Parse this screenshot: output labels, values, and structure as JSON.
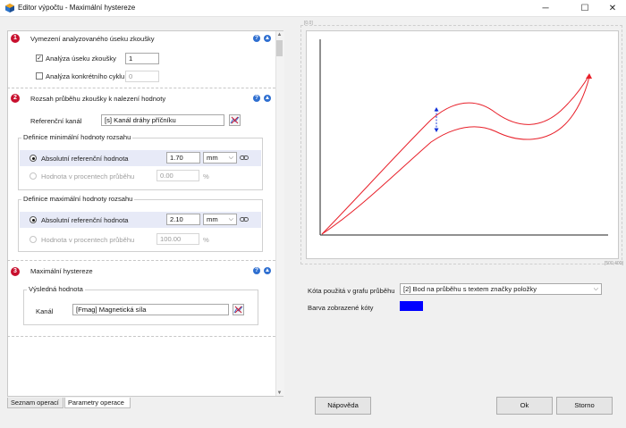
{
  "window": {
    "title": "Editor výpočtu - Maximální hystereze",
    "controls": {
      "minimize": "─",
      "maximize": "☐",
      "close": "✕"
    }
  },
  "section1": {
    "num": "1",
    "title": "Vymezení analyzovaného úseku zkoušky",
    "help": "?",
    "collapse": "▲",
    "analyza_useku": {
      "checked": true,
      "label": "Analýza úseku zkoušky",
      "value": "1"
    },
    "analyza_cyklu": {
      "checked": false,
      "label": "Analýza konkrétního cyklu",
      "value": "0"
    }
  },
  "section2": {
    "num": "2",
    "title": "Rozsah průběhu zkoušky k nalezení hodnoty",
    "help": "?",
    "collapse": "▲",
    "ref_channel_label": "Referenční kanál",
    "ref_channel_value": "[s]  Kanál dráhy příčníku",
    "min_group": {
      "title": "Definice minimální hodnoty rozsahu",
      "abs_label": "Absolutní referenční hodnota",
      "abs_value": "1.70",
      "unit": "mm",
      "pct_label": "Hodnota v procentech průběhu",
      "pct_value": "0.00",
      "pct_unit": "%"
    },
    "max_group": {
      "title": "Definice maximální hodnoty rozsahu",
      "abs_label": "Absolutní referenční hodnota",
      "abs_value": "2.10",
      "unit": "mm",
      "pct_label": "Hodnota v procentech průběhu",
      "pct_value": "100.00",
      "pct_unit": "%"
    }
  },
  "section3": {
    "num": "3",
    "title": "Maximální hystereze",
    "help": "?",
    "collapse": "▲",
    "result_group_title": "Výsledná hodnota",
    "channel_label": "Kanál",
    "channel_value": "[Fmag]  Magnetická síla"
  },
  "tabs": [
    "Seznam operací",
    "Parametry operace"
  ],
  "chart": {
    "corner_top_left": "[0,0]",
    "corner_bottom_right": "[500,400]",
    "colors": {
      "curve": "#e8202a",
      "arrow": "#1030d8",
      "axis": "#222222"
    }
  },
  "kota": {
    "label": "Kóta použitá v grafu průběhu",
    "value": "[2]  Bod na průběhu s textem značky položky"
  },
  "barva": {
    "label": "Barva zobrazené kóty",
    "color": "#0000ff"
  },
  "buttons": {
    "help": "Nápověda",
    "ok": "Ok",
    "cancel": "Storno"
  }
}
